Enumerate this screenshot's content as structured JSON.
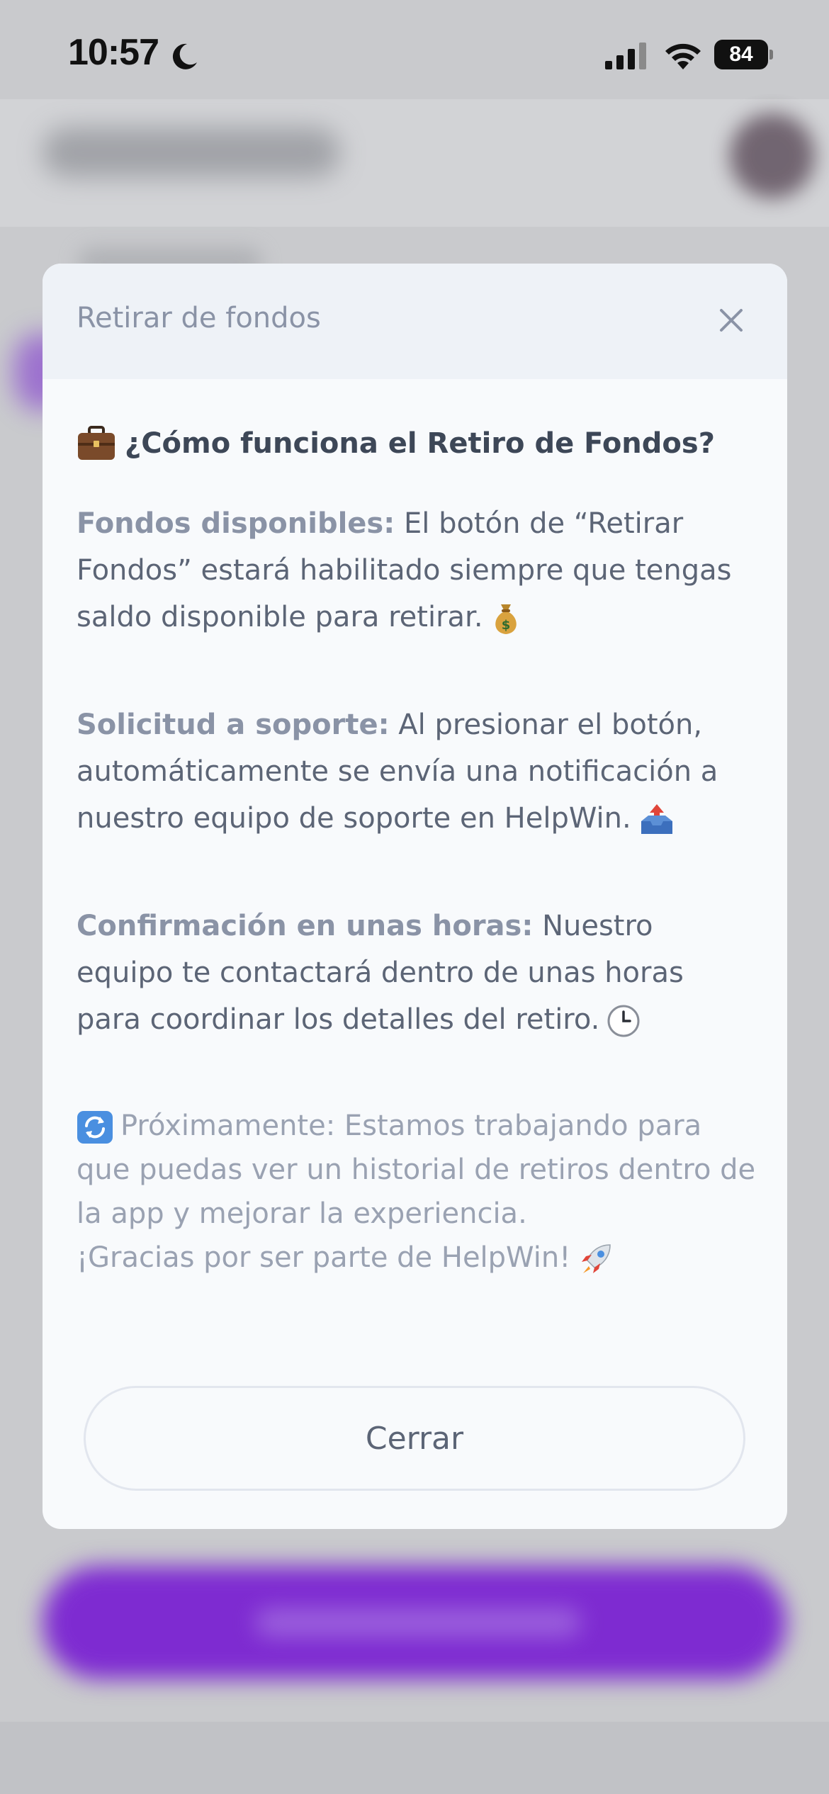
{
  "status_bar": {
    "time": "10:57",
    "battery": "84"
  },
  "modal": {
    "title": "Retirar de fondos",
    "heading": "¿Cómo funciona el Retiro de Fondos?",
    "items": [
      {
        "label": "Fondos disponibles:",
        "text": " El botón de “Retirar Fondos” estará habilitado siempre que tengas saldo disponible para retirar.",
        "emoji": "money-bag-icon"
      },
      {
        "label": "Solicitud a soporte:",
        "text": " Al presionar el botón, automáticamente se envía una notificación a nuestro equipo de soporte en HelpWin.",
        "emoji": "outbox-tray-icon"
      },
      {
        "label": "Confirmación en unas horas:",
        "text": " Nuestro equipo te contactará dentro de unas horas para coordinar los detalles del retiro.",
        "emoji": "clock-icon"
      }
    ],
    "note_line1": "Próximamente: Estamos trabajando para que puedas ver un historial de retiros dentro de la app y mejorar la experiencia.",
    "note_line2": "¡Gracias por ser parte de HelpWin!",
    "close_button_label": "Cerrar"
  },
  "colors": {
    "accent_purple": "#7e2bd1",
    "modal_bg": "#f8fafc",
    "header_bg": "#eef2f7",
    "text_primary": "#3d4757",
    "text_muted": "#8a93a6"
  }
}
